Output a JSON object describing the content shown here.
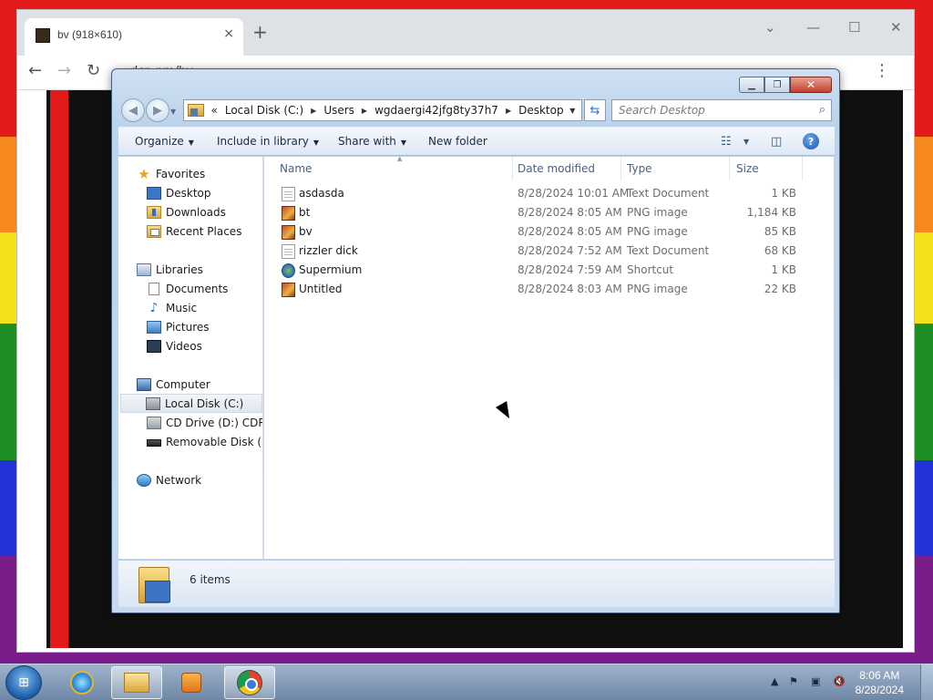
{
  "browser": {
    "tab_title": "bv (918×610)",
    "tab_close": "×",
    "new_tab": "+",
    "url": "dcp.pm/bv"
  },
  "explorer": {
    "breadcrumb_overflow": "«",
    "breadcrumbs": [
      "Local Disk (C:)",
      "Users",
      "wgdaergi42jfg8ty37h7",
      "Desktop"
    ],
    "search_placeholder": "Search Desktop",
    "toolbar": {
      "organize": "Organize",
      "include_in_library": "Include in library",
      "share_with": "Share with",
      "new_folder": "New folder"
    },
    "nav": {
      "favorites": "Favorites",
      "desktop": "Desktop",
      "downloads": "Downloads",
      "recent_places": "Recent Places",
      "libraries": "Libraries",
      "documents": "Documents",
      "music": "Music",
      "pictures": "Pictures",
      "videos": "Videos",
      "computer": "Computer",
      "local_disk": "Local Disk (C:)",
      "cd_drive": "CD Drive (D:) CDROM",
      "removable_disk": "Removable Disk (E:)",
      "network": "Network"
    },
    "columns": {
      "name": "Name",
      "date_modified": "Date modified",
      "type": "Type",
      "size": "Size"
    },
    "files": [
      {
        "name": "asdasda",
        "date": "8/28/2024 10:01 AM",
        "type": "Text Document",
        "size": "1 KB",
        "icon": "text-file-icon"
      },
      {
        "name": "bt",
        "date": "8/28/2024 8:05 AM",
        "type": "PNG image",
        "size": "1,184 KB",
        "icon": "png-image-icon"
      },
      {
        "name": "bv",
        "date": "8/28/2024 8:05 AM",
        "type": "PNG image",
        "size": "85 KB",
        "icon": "png-image-icon"
      },
      {
        "name": "rizzler dick",
        "date": "8/28/2024 7:52 AM",
        "type": "Text Document",
        "size": "68 KB",
        "icon": "text-file-icon"
      },
      {
        "name": "Supermium",
        "date": "8/28/2024 7:59 AM",
        "type": "Shortcut",
        "size": "1 KB",
        "icon": "shortcut-icon"
      },
      {
        "name": "Untitled",
        "date": "8/28/2024 8:03 AM",
        "type": "PNG image",
        "size": "22 KB",
        "icon": "png-image-icon"
      }
    ],
    "item_count": "6 items"
  },
  "taskbar": {
    "time": "8:06 AM",
    "date": "8/28/2024"
  }
}
